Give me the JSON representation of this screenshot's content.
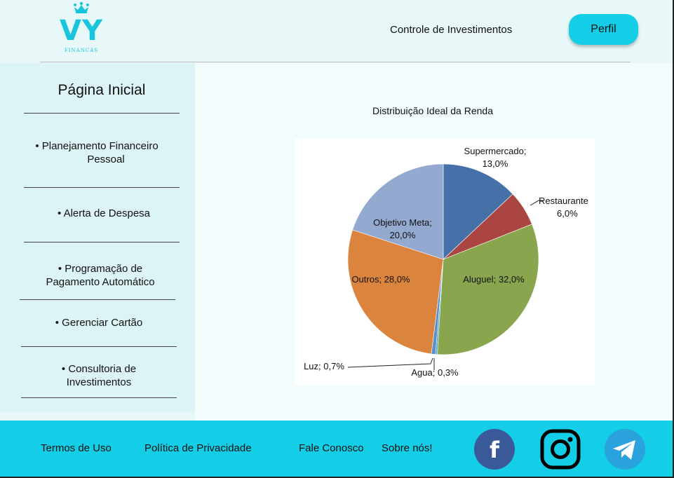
{
  "logo": {
    "text": "VY",
    "subtext": "FINANCAS",
    "crown_color": "#18c5dc"
  },
  "header": {
    "title": "Controle de Investimentos",
    "profile_label": "Perfil"
  },
  "sidebar": {
    "title": "Página Inicial",
    "items": [
      {
        "line1": "• Planejamento Financeiro",
        "line2": "Pessoal"
      },
      {
        "line1": "• Alerta de Despesa",
        "line2": ""
      },
      {
        "line1": "• Programação de",
        "line2": "Pagamento Automático"
      },
      {
        "line1": "• Gerenciar Cartão",
        "line2": ""
      },
      {
        "line1": "• Consultoria de",
        "line2": "Investimentos"
      }
    ]
  },
  "chart_data": {
    "type": "pie",
    "title": "Distribuição Ideal da Renda",
    "slices": [
      {
        "label": "Supermercado",
        "value": 13.0,
        "text": "Supermercado;",
        "pct": "13,0%",
        "color": "#4571a8"
      },
      {
        "label": "Restaurante",
        "value": 6.0,
        "text": "Restaurante",
        "pct": "6,0%",
        "color": "#aa4542"
      },
      {
        "label": "Aluguel",
        "value": 32.0,
        "text": "Aluguel; 32,0%",
        "pct": "",
        "color": "#89a54e"
      },
      {
        "label": "Agua",
        "value": 0.3,
        "text": "Agua; 0,3%",
        "pct": "",
        "color": "#4aa3c4"
      },
      {
        "label": "Luz",
        "value": 0.7,
        "text": "Luz; 0,7%",
        "pct": "",
        "color": "#5b8fc9"
      },
      {
        "label": "Outros",
        "value": 28.0,
        "text": "Outros; 28,0%",
        "pct": "",
        "color": "#db843d"
      },
      {
        "label": "Objetivo Meta",
        "value": 20.0,
        "text": "Objetivo Meta;",
        "pct": "20,0%",
        "color": "#93a9cf"
      }
    ]
  },
  "footer": {
    "links": [
      "Termos de Uso",
      "Política de Privacidade",
      "Fale Conosco",
      "Sobre nós!"
    ],
    "social": [
      {
        "name": "facebook",
        "glyph": "f",
        "color": "#3a5998"
      },
      {
        "name": "instagram",
        "color": "#000000"
      },
      {
        "name": "telegram",
        "color": "#2aa2dc"
      }
    ]
  }
}
